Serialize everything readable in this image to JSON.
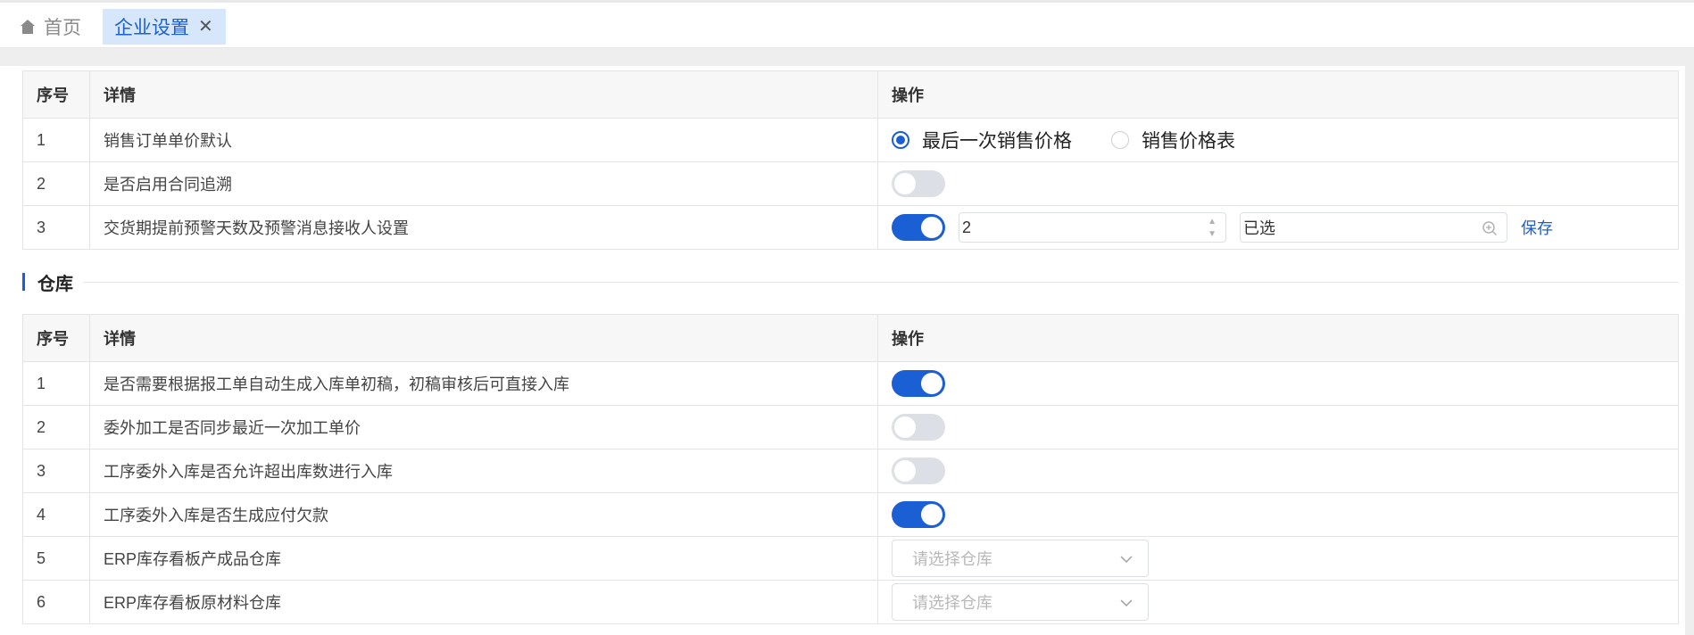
{
  "tabs": {
    "home": "首页",
    "active": "企业设置",
    "close_glyph": "✕"
  },
  "table1": {
    "headers": {
      "no": "序号",
      "detail": "详情",
      "op": "操作"
    },
    "rows": [
      {
        "no": "1",
        "detail": "销售订单单价默认"
      },
      {
        "no": "2",
        "detail": "是否启用合同追溯",
        "switch": false
      },
      {
        "no": "3",
        "detail": "交货期提前预警天数及预警消息接收人设置",
        "switch": true
      }
    ],
    "radio": {
      "option1": "最后一次销售价格",
      "option2": "销售价格表",
      "selected": "option1"
    },
    "warn_days": "2",
    "receiver_value": "已选",
    "save_label": "保存"
  },
  "section": {
    "title": "仓库"
  },
  "table2": {
    "headers": {
      "no": "序号",
      "detail": "详情",
      "op": "操作"
    },
    "rows": [
      {
        "no": "1",
        "detail": "是否需要根据报工单自动生成入库单初稿，初稿审核后可直接入库",
        "switch": true
      },
      {
        "no": "2",
        "detail": "委外加工是否同步最近一次加工单价",
        "switch": false
      },
      {
        "no": "3",
        "detail": "工序委外入库是否允许超出库数进行入库",
        "switch": false
      },
      {
        "no": "4",
        "detail": "工序委外入库是否生成应付欠款",
        "switch": true
      },
      {
        "no": "5",
        "detail": "ERP库存看板产成品仓库"
      },
      {
        "no": "6",
        "detail": "ERP库存看板原材料仓库"
      }
    ],
    "select_placeholder": "请选择仓库"
  },
  "colors": {
    "accent": "#1a5fd4",
    "tab_active_bg": "#d6e6fb",
    "switch_off": "#dcdfe6"
  }
}
